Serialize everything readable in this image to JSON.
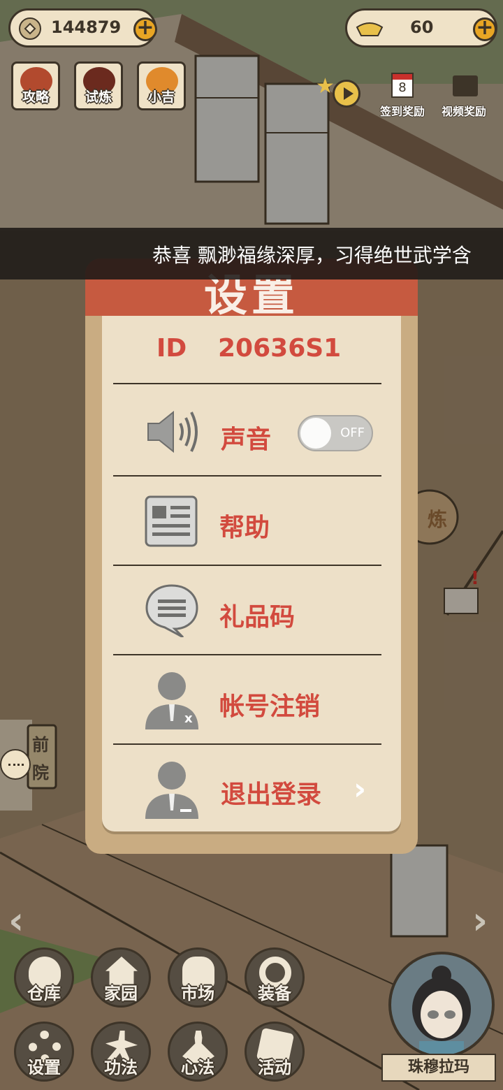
{
  "currency": {
    "coins": "144879",
    "gold": "60"
  },
  "top_buttons": [
    {
      "label": "攻略"
    },
    {
      "label": "试炼"
    },
    {
      "label": "小吉"
    }
  ],
  "rewards": {
    "checkin": "签到奖励",
    "video": "视频奖励",
    "calendar_day": "8"
  },
  "announcement": "恭喜  飘渺福缘深厚，习得绝世武学含",
  "settings": {
    "title": "设置",
    "id_label": "ID",
    "id_value": "20636S1",
    "sound_label": "声音",
    "sound_state": "OFF",
    "help_label": "帮助",
    "gift_label": "礼品码",
    "delete_label": "帐号注销",
    "delete_mark": "x",
    "logout_label": "退出登录"
  },
  "side": {
    "courtyard_1": "前",
    "courtyard_2": "院",
    "practice": "炼"
  },
  "bottom_menu": [
    {
      "label": "仓库"
    },
    {
      "label": "家园"
    },
    {
      "label": "市场"
    },
    {
      "label": "装备"
    },
    {
      "label": "设置"
    },
    {
      "label": "功法"
    },
    {
      "label": "心法"
    },
    {
      "label": "活动"
    }
  ],
  "player": {
    "name": "珠穆拉玛"
  },
  "colors": {
    "accent_red": "#d24a3e",
    "header_red": "#c65a40",
    "panel": "#ede0c8",
    "gold": "#e8a524"
  }
}
